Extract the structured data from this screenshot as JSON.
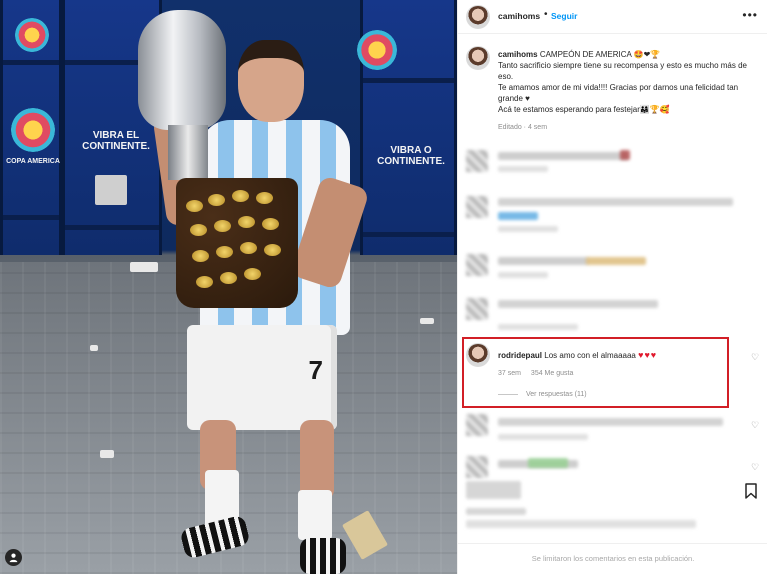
{
  "post": {
    "author": "camihoms",
    "follow_label": "Seguir",
    "more_label": "•••",
    "dot": "•"
  },
  "caption": {
    "author": "camihoms",
    "line1": "CAMPEÓN DE AMERICA 🤩❤🏆",
    "line2": "Tanto sacrificio siempre tiene su recompensa y esto es mucho más de eso.",
    "line3": "Te amamos amor de mi vida!!!! Gracias por darnos una felicidad tan grande ♥",
    "line4": "Acá te estamos esperando para festejar👨‍👩‍👧🏆🥰",
    "edited": "Editado · 4 sem"
  },
  "photo": {
    "banner_left": "VIBRA EL CONTINENTE.",
    "banner_right": "VIBRA O CONTINENTE.",
    "banner_small": "COPA AMERICA",
    "shorts_number": "7"
  },
  "highlighted_comment": {
    "author": "rodridepaul",
    "text": "Los amo con el almaaaaa",
    "hearts": "♥♥♥",
    "time": "37 sem",
    "likes": "354 Me gusta",
    "replies": "Ver respuestas (11)"
  },
  "footer": {
    "comments_limited": "Se limitaron los comentarios en esta publicación."
  },
  "icons": {
    "like": "heart-outline-icon",
    "save": "bookmark-icon",
    "more": "more-options-icon",
    "user": "user-tag-icon"
  },
  "colors": {
    "follow_blue": "#0095f6",
    "highlight_red": "#d21f26",
    "heart_red": "#e0192d"
  }
}
